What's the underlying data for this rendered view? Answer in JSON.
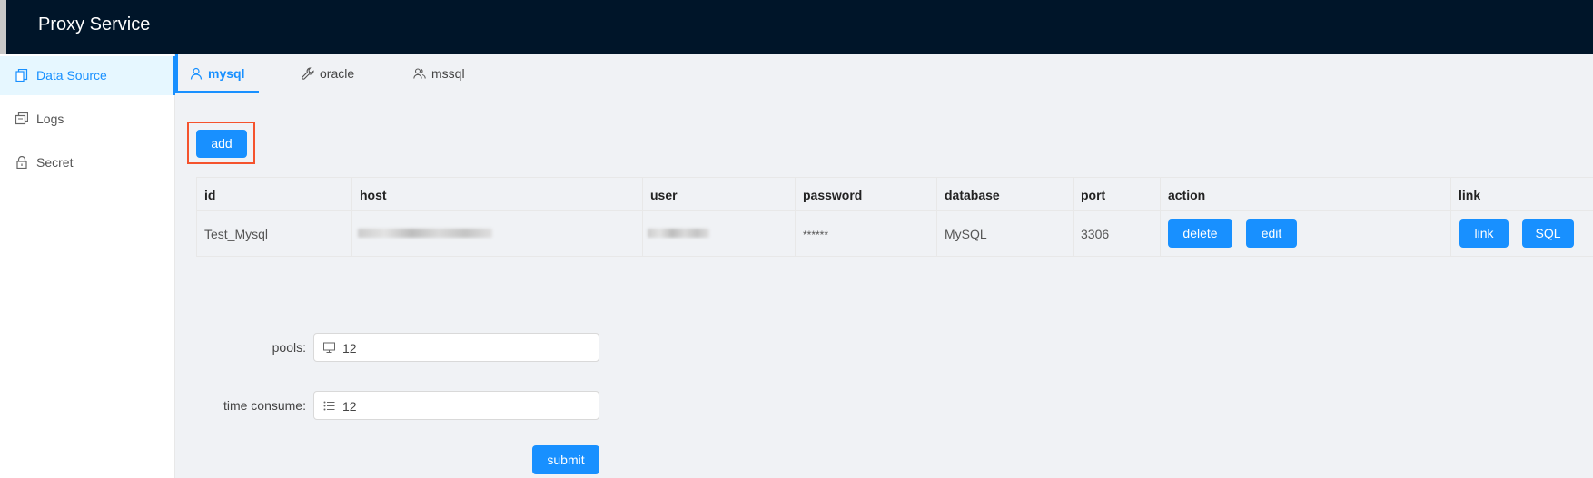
{
  "header": {
    "title": "Proxy Service"
  },
  "sidebar": {
    "items": [
      {
        "label": "Data Source",
        "icon": "copy-icon",
        "active": true
      },
      {
        "label": "Logs",
        "icon": "logs-icon",
        "active": false
      },
      {
        "label": "Secret",
        "icon": "lock-icon",
        "active": false
      }
    ]
  },
  "tabs": [
    {
      "label": "mysql",
      "icon": "user-icon",
      "active": true
    },
    {
      "label": "oracle",
      "icon": "wrench-icon",
      "active": false
    },
    {
      "label": "mssql",
      "icon": "team-icon",
      "active": false
    }
  ],
  "toolbar": {
    "add_label": "add"
  },
  "table": {
    "columns": [
      "id",
      "host",
      "user",
      "password",
      "database",
      "port",
      "action",
      "link"
    ],
    "rows": [
      {
        "id": "Test_Mysql",
        "host": "",
        "user": "",
        "password": "******",
        "database": "MySQL",
        "port": "3306",
        "actions": [
          "delete",
          "edit"
        ],
        "links": [
          "link",
          "SQL"
        ]
      }
    ]
  },
  "form": {
    "pools_label": "pools:",
    "pools_value": "12",
    "time_label": "time consume:",
    "time_value": "12",
    "submit_label": "submit"
  },
  "colors": {
    "header_bg": "#001529",
    "accent": "#1890ff",
    "highlight": "#f5532d"
  }
}
